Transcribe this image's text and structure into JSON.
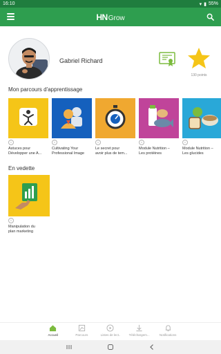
{
  "status": {
    "time": "16:10",
    "battery": "55%"
  },
  "appbar": {
    "logo_bold": "HN",
    "logo_light": "Grow"
  },
  "profile": {
    "name": "Gabriel Richard",
    "points": "130 points"
  },
  "sections": {
    "learning_path": "Mon parcours d'apprentissage",
    "featured": "En vedette"
  },
  "courses": [
    {
      "title": "Astuces pour\nDévelopper une A...",
      "color": "#f5c518",
      "icon": "person-star-icon"
    },
    {
      "title": "Cultivating Your\nProfessional Image",
      "color": "#1560bd",
      "icon": "professional-person-icon"
    },
    {
      "title": "Le secret pour\navoir plus de tem...",
      "color": "#f0a830",
      "icon": "stopwatch-icon"
    },
    {
      "title": "Module Nutrition –\nLes protéines",
      "color": "#c0449a",
      "icon": "protein-food-icon"
    },
    {
      "title": "Module Nutrition –\nLes glucides",
      "color": "#29a8d8",
      "icon": "carbs-food-icon"
    }
  ],
  "featured": [
    {
      "title": "Manipulation du\nplan marketing",
      "color": "#f5c518",
      "icon": "chart-hand-icon"
    }
  ],
  "nav": [
    {
      "label": "Accueil",
      "icon": "home-icon"
    },
    {
      "label": "Parcours",
      "icon": "path-icon"
    },
    {
      "label": "Listes de lect..",
      "icon": "playlist-icon"
    },
    {
      "label": "Téléchargem...",
      "icon": "download-icon"
    },
    {
      "label": "Notifications",
      "icon": "bell-icon"
    }
  ],
  "colors": {
    "brand": "#2e9e4f",
    "statusbar": "#1f7d3e",
    "star": "#f5c518"
  }
}
